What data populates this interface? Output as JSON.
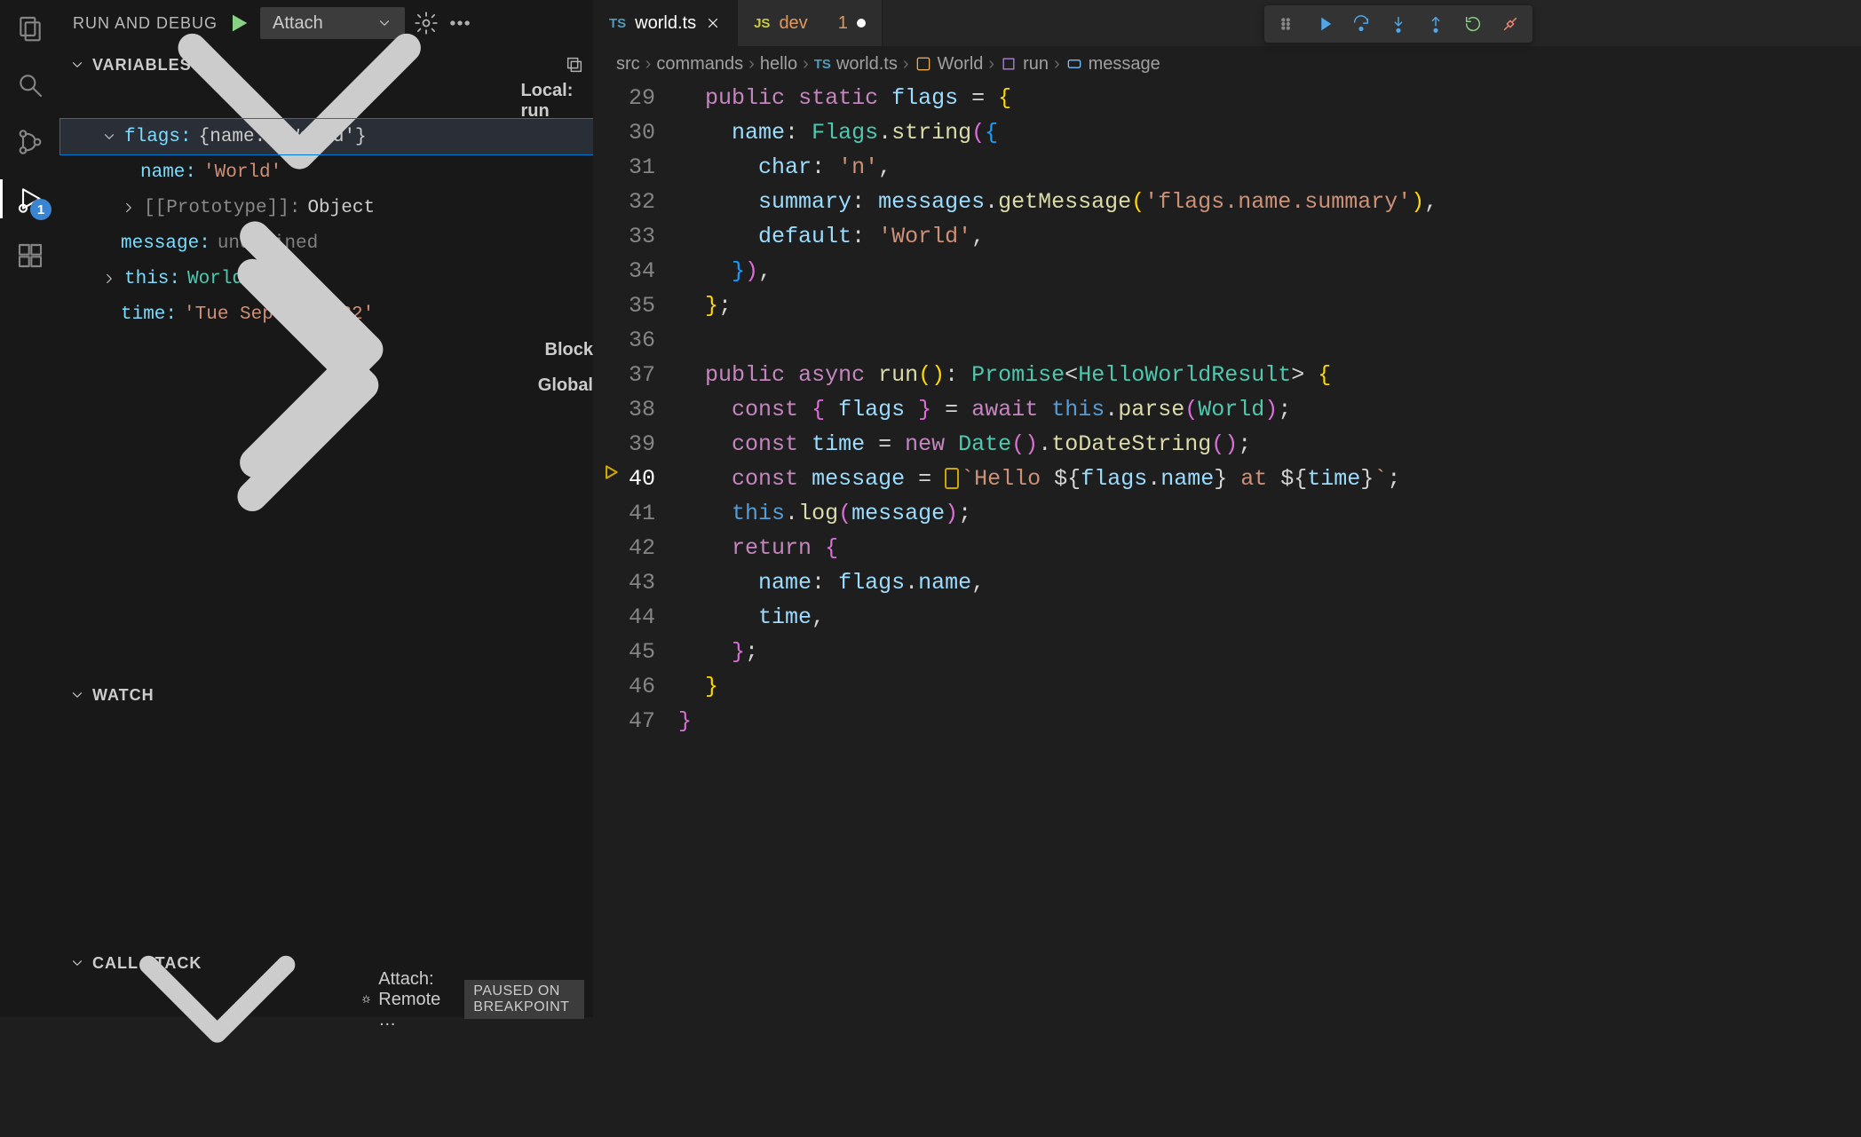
{
  "activity_badge": "1",
  "side": {
    "title": "RUN AND DEBUG",
    "config": "Attach"
  },
  "variables": {
    "header": "VARIABLES",
    "local_scope": "Local: run",
    "flags_label": "flags:",
    "flags_value": "{name: 'World'}",
    "name_label": "name:",
    "name_value": "'World'",
    "proto_label": "[[Prototype]]:",
    "proto_value": "Object",
    "message_label": "message:",
    "message_value": "undefined",
    "this_label": "this:",
    "this_value": "World",
    "time_label": "time:",
    "time_value": "'Tue Sep 06 2022'",
    "block_scope": "Block",
    "global_scope": "Global"
  },
  "watch": {
    "header": "WATCH"
  },
  "callstack": {
    "header": "CALL STACK",
    "item": "Attach: Remote …",
    "badge": "PAUSED ON BREAKPOINT"
  },
  "tabs": {
    "t1_icon": "TS",
    "t1_name": "world.ts",
    "t2_icon": "JS",
    "t2_name": "dev",
    "t2_mod": "1"
  },
  "breadcrumb": {
    "p1": "src",
    "p2": "commands",
    "p3": "hello",
    "p4_icon": "TS",
    "p4": "world.ts",
    "p5": "World",
    "p6": "run",
    "p7": "message"
  },
  "line_numbers": [
    "29",
    "30",
    "31",
    "32",
    "33",
    "34",
    "35",
    "36",
    "37",
    "38",
    "39",
    "40",
    "41",
    "42",
    "43",
    "44",
    "45",
    "46",
    "47"
  ],
  "code": {
    "l29_kw1": "public",
    "l29_kw2": "static",
    "l29_prop": "flags",
    "l29_eq": " = ",
    "l30_prop": "name",
    "l30_col": ": ",
    "l30_cls": "Flags",
    "l30_fn": "string",
    "l31_prop": "char",
    "l31_col": ": ",
    "l31_str": "'n'",
    "l32_prop": "summary",
    "l32_col": ": ",
    "l32_var": "messages",
    "l32_fn": "getMessage",
    "l32_str": "'flags.name.summary'",
    "l33_prop": "default",
    "l33_col": ": ",
    "l33_str": "'World'",
    "l37_kw1": "public",
    "l37_kw2": "async",
    "l37_fn": "run",
    "l37_ret": "Promise",
    "l37_gen": "HelloWorldResult",
    "l38_kw": "const",
    "l38_var": "flags",
    "l38_kw2": "await",
    "l38_this": "this",
    "l38_fn": "parse",
    "l38_cls": "World",
    "l39_kw": "const",
    "l39_var": "time",
    "l39_kw2": "new",
    "l39_cls": "Date",
    "l39_fn": "toDateString",
    "l40_kw": "const",
    "l40_var": "message",
    "l40_s1": "`Hello ",
    "l40_v1": "flags",
    "l40_v1b": "name",
    "l40_s2": " at ",
    "l40_v2": "time",
    "l40_s3": "`",
    "l41_this": "this",
    "l41_fn": "log",
    "l41_arg": "message",
    "l42_kw": "return",
    "l43_prop": "name",
    "l43_v": "flags",
    "l43_vb": "name",
    "l44_prop": "time"
  }
}
